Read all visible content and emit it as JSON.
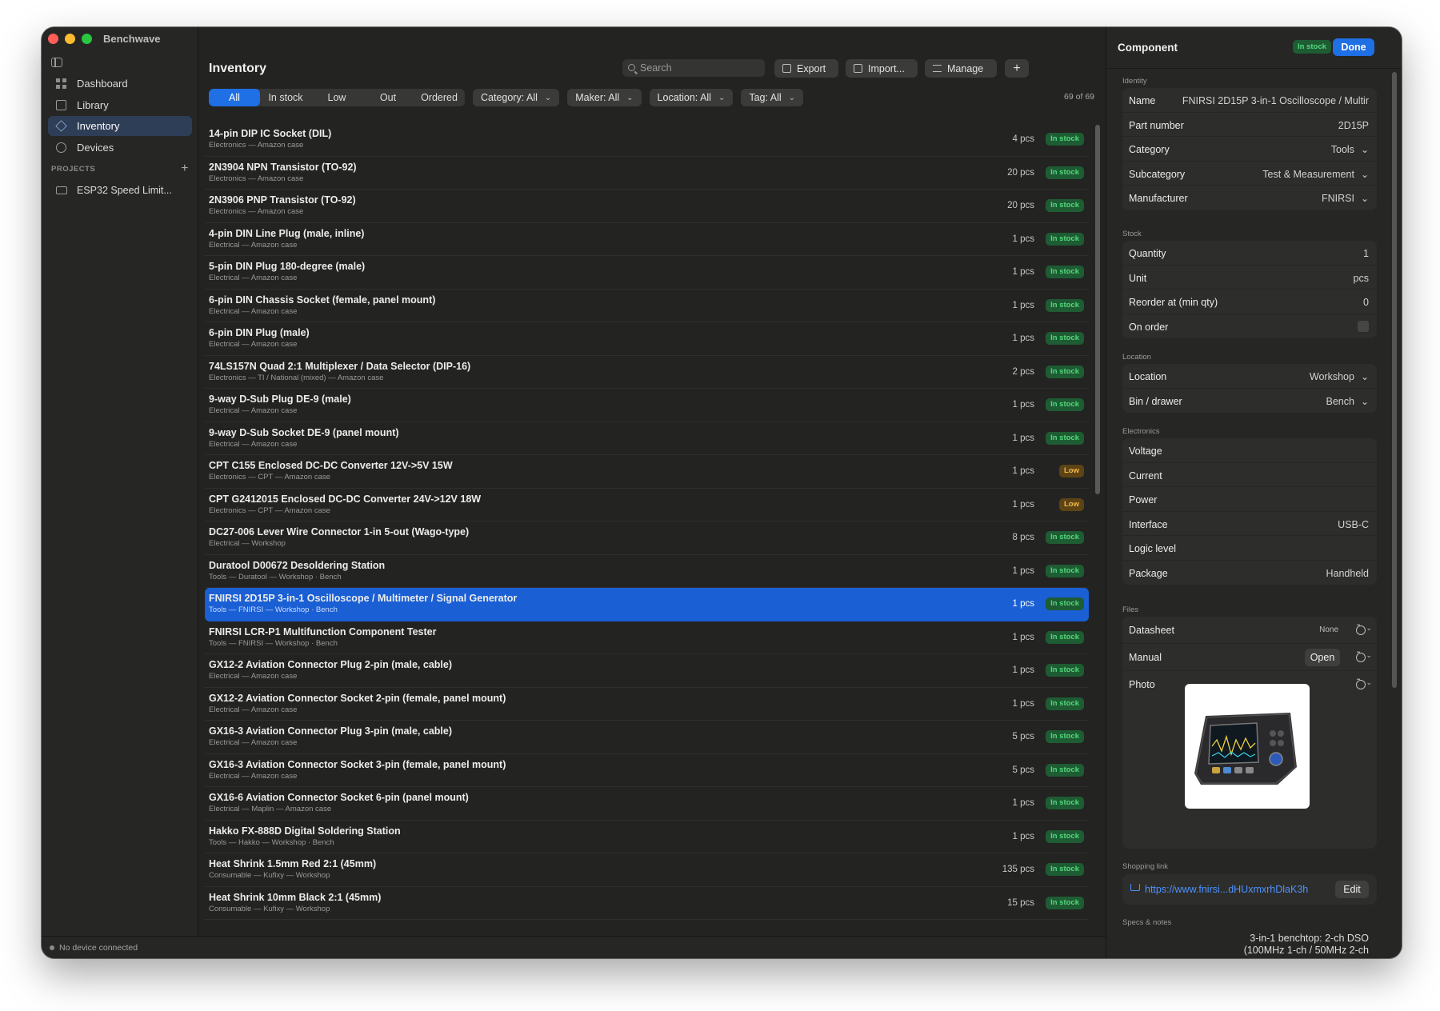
{
  "app": {
    "name": "Benchwave"
  },
  "sidebar": {
    "items": [
      {
        "label": "Dashboard",
        "icon": "grid-icon"
      },
      {
        "label": "Library",
        "icon": "library-icon"
      },
      {
        "label": "Inventory",
        "icon": "cube-icon",
        "active": true
      },
      {
        "label": "Devices",
        "icon": "device-icon"
      }
    ],
    "projects_header": "PROJECTS",
    "projects_add": "+",
    "projects": [
      {
        "label": "ESP32 Speed Limit..."
      }
    ]
  },
  "status_bar": {
    "text": "No device connected"
  },
  "inventory": {
    "title": "Inventory",
    "search_placeholder": "Search",
    "toolbar": {
      "export": "Export",
      "import": "Import...",
      "manage": "Manage",
      "add": "+"
    },
    "status_filters": [
      "All",
      "In stock",
      "Low",
      "Out",
      "Ordered"
    ],
    "dropdowns": [
      "Category: All",
      "Maker: All",
      "Location: All",
      "Tag: All"
    ],
    "count": "69 of 69",
    "rows": [
      {
        "name": "14-pin DIP IC Socket (DIL)",
        "sub": "Electronics — Amazon case",
        "qty": "4 pcs",
        "badge": "In stock",
        "status": "in"
      },
      {
        "name": "2N3904 NPN Transistor (TO-92)",
        "sub": "Electronics — Amazon case",
        "qty": "20 pcs",
        "badge": "In stock",
        "status": "in"
      },
      {
        "name": "2N3906 PNP Transistor (TO-92)",
        "sub": "Electronics — Amazon case",
        "qty": "20 pcs",
        "badge": "In stock",
        "status": "in"
      },
      {
        "name": "4-pin DIN Line Plug (male, inline)",
        "sub": "Electrical — Amazon case",
        "qty": "1 pcs",
        "badge": "In stock",
        "status": "in"
      },
      {
        "name": "5-pin DIN Plug 180-degree (male)",
        "sub": "Electrical — Amazon case",
        "qty": "1 pcs",
        "badge": "In stock",
        "status": "in"
      },
      {
        "name": "6-pin DIN Chassis Socket (female, panel mount)",
        "sub": "Electrical — Amazon case",
        "qty": "1 pcs",
        "badge": "In stock",
        "status": "in"
      },
      {
        "name": "6-pin DIN Plug (male)",
        "sub": "Electrical — Amazon case",
        "qty": "1 pcs",
        "badge": "In stock",
        "status": "in"
      },
      {
        "name": "74LS157N Quad 2:1 Multiplexer / Data Selector (DIP-16)",
        "sub": "Electronics — TI / National (mixed) — Amazon case",
        "qty": "2 pcs",
        "badge": "In stock",
        "status": "in"
      },
      {
        "name": "9-way D-Sub Plug DE-9 (male)",
        "sub": "Electrical — Amazon case",
        "qty": "1 pcs",
        "badge": "In stock",
        "status": "in"
      },
      {
        "name": "9-way D-Sub Socket DE-9 (panel mount)",
        "sub": "Electrical — Amazon case",
        "qty": "1 pcs",
        "badge": "In stock",
        "status": "in"
      },
      {
        "name": "CPT C155 Enclosed DC-DC Converter 12V->5V 15W",
        "sub": "Electronics — CPT — Amazon case",
        "qty": "1 pcs",
        "badge": "Low",
        "status": "low"
      },
      {
        "name": "CPT G2412015 Enclosed DC-DC Converter 24V->12V 18W",
        "sub": "Electronics — CPT — Amazon case",
        "qty": "1 pcs",
        "badge": "Low",
        "status": "low"
      },
      {
        "name": "DC27-006 Lever Wire Connector 1-in 5-out (Wago-type)",
        "sub": "Electrical — Workshop",
        "qty": "8 pcs",
        "badge": "In stock",
        "status": "in"
      },
      {
        "name": "Duratool D00672 Desoldering Station",
        "sub": "Tools — Duratool — Workshop · Bench",
        "qty": "1 pcs",
        "badge": "In stock",
        "status": "in"
      },
      {
        "name": "FNIRSI 2D15P 3-in-1 Oscilloscope / Multimeter / Signal Generator",
        "sub": "Tools — FNIRSI — Workshop · Bench",
        "qty": "1 pcs",
        "badge": "In stock",
        "status": "in",
        "selected": true
      },
      {
        "name": "FNIRSI LCR-P1 Multifunction Component Tester",
        "sub": "Tools — FNIRSI — Workshop · Bench",
        "qty": "1 pcs",
        "badge": "In stock",
        "status": "in"
      },
      {
        "name": "GX12-2 Aviation Connector Plug 2-pin (male, cable)",
        "sub": "Electrical — Amazon case",
        "qty": "1 pcs",
        "badge": "In stock",
        "status": "in"
      },
      {
        "name": "GX12-2 Aviation Connector Socket 2-pin (female, panel mount)",
        "sub": "Electrical — Amazon case",
        "qty": "1 pcs",
        "badge": "In stock",
        "status": "in"
      },
      {
        "name": "GX16-3 Aviation Connector Plug 3-pin (male, cable)",
        "sub": "Electrical — Amazon case",
        "qty": "5 pcs",
        "badge": "In stock",
        "status": "in"
      },
      {
        "name": "GX16-3 Aviation Connector Socket 3-pin (female, panel mount)",
        "sub": "Electrical — Amazon case",
        "qty": "5 pcs",
        "badge": "In stock",
        "status": "in"
      },
      {
        "name": "GX16-6 Aviation Connector Socket 6-pin (panel mount)",
        "sub": "Electrical — Maplin — Amazon case",
        "qty": "1 pcs",
        "badge": "In stock",
        "status": "in"
      },
      {
        "name": "Hakko FX-888D Digital Soldering Station",
        "sub": "Tools — Hakko — Workshop · Bench",
        "qty": "1 pcs",
        "badge": "In stock",
        "status": "in"
      },
      {
        "name": "Heat Shrink 1.5mm Red 2:1 (45mm)",
        "sub": "Consumable — Kufixy — Workshop",
        "qty": "135 pcs",
        "badge": "In stock",
        "status": "in"
      },
      {
        "name": "Heat Shrink 10mm Black 2:1 (45mm)",
        "sub": "Consumable — Kufixy — Workshop",
        "qty": "15 pcs",
        "badge": "In stock",
        "status": "in"
      }
    ]
  },
  "detail": {
    "title": "Component",
    "badge": "In stock",
    "done": "Done",
    "sections": {
      "identity": {
        "label": "Identity",
        "fields": [
          {
            "label": "Name",
            "value": "FNIRSI 2D15P 3-in-1 Oscilloscope / Multir"
          },
          {
            "label": "Part number",
            "value": "2D15P"
          },
          {
            "label": "Category",
            "value": "Tools",
            "dropdown": true
          },
          {
            "label": "Subcategory",
            "value": "Test & Measurement",
            "dropdown": true
          },
          {
            "label": "Manufacturer",
            "value": "FNIRSI",
            "dropdown": true
          }
        ]
      },
      "stock": {
        "label": "Stock",
        "fields": [
          {
            "label": "Quantity",
            "value": "1"
          },
          {
            "label": "Unit",
            "value": "pcs"
          },
          {
            "label": "Reorder at (min qty)",
            "value": "0"
          },
          {
            "label": "On order",
            "checkbox": true
          }
        ]
      },
      "location": {
        "label": "Location",
        "fields": [
          {
            "label": "Location",
            "value": "Workshop",
            "dropdown": true
          },
          {
            "label": "Bin / drawer",
            "value": "Bench",
            "dropdown": true
          }
        ]
      },
      "electronics": {
        "label": "Electronics",
        "fields": [
          {
            "label": "Voltage",
            "value": ""
          },
          {
            "label": "Current",
            "value": ""
          },
          {
            "label": "Power",
            "value": ""
          },
          {
            "label": "Interface",
            "value": "USB-C"
          },
          {
            "label": "Logic level",
            "value": ""
          },
          {
            "label": "Package",
            "value": "Handheld"
          }
        ]
      },
      "files": {
        "label": "Files",
        "datasheet": {
          "label": "Datasheet",
          "value": "None"
        },
        "manual": {
          "label": "Manual",
          "open": "Open"
        },
        "photo": {
          "label": "Photo"
        }
      },
      "shopping": {
        "label": "Shopping link",
        "url": "https://www.fnirsi...dHUxmxrhDlaK3h",
        "edit": "Edit"
      },
      "notes": {
        "label": "Specs & notes",
        "line1": "3-in-1 benchtop: 2-ch DSO",
        "line2": "(100MHz 1-ch / 50MHz 2-ch"
      }
    }
  }
}
